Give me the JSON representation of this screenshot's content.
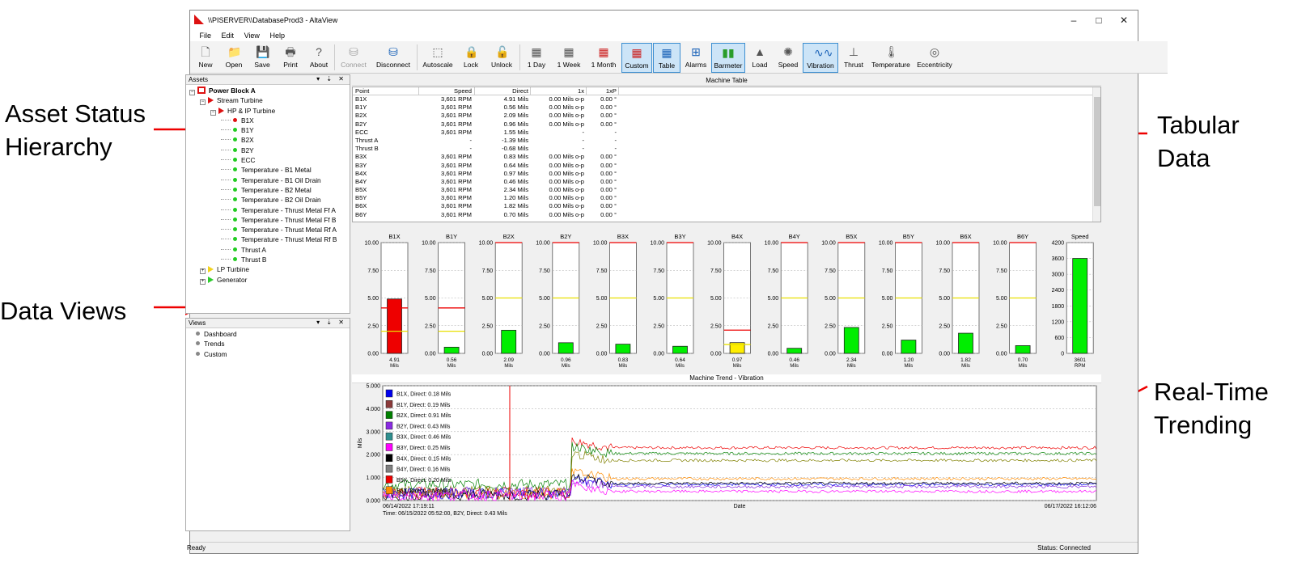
{
  "callouts": {
    "asset_status": "Asset Status\nHierarchy",
    "tabular": "Tabular\nData",
    "data_views": "Data Views",
    "trending": "Real-Time\nTrending"
  },
  "window": {
    "title": "\\\\PISERVER\\\\DatabaseProd3 - AltaView",
    "controls": [
      "–",
      "□",
      "✕"
    ]
  },
  "menu": [
    "File",
    "Edit",
    "View",
    "Help"
  ],
  "toolbar": [
    {
      "label": "New",
      "icon": "new-file-icon",
      "glyph": "🗋"
    },
    {
      "label": "Open",
      "icon": "folder-icon",
      "glyph": "📁"
    },
    {
      "label": "Save",
      "icon": "save-icon",
      "glyph": "💾"
    },
    {
      "label": "Print",
      "icon": "print-icon",
      "glyph": "🖶"
    },
    {
      "label": "About",
      "icon": "help-icon",
      "glyph": "?"
    },
    {
      "label": "Connect",
      "icon": "database-icon",
      "glyph": "⛁",
      "disabled": true
    },
    {
      "label": "Disconnect",
      "icon": "database-icon",
      "glyph": "⛁"
    },
    {
      "label": "Autoscale",
      "icon": "autoscale-icon",
      "glyph": "⬚"
    },
    {
      "label": "Lock",
      "icon": "lock-icon",
      "glyph": "🔒"
    },
    {
      "label": "Unlock",
      "icon": "unlock-icon",
      "glyph": "🔓"
    },
    {
      "label": "1 Day",
      "icon": "calendar-icon",
      "glyph": "▦"
    },
    {
      "label": "1 Week",
      "icon": "calendar-icon",
      "glyph": "▦"
    },
    {
      "label": "1 Month",
      "icon": "calendar-icon",
      "glyph": "▦"
    },
    {
      "label": "Custom",
      "icon": "calendar-custom-icon",
      "glyph": "▦",
      "selected": true
    },
    {
      "label": "Table",
      "icon": "table-icon",
      "glyph": "▦",
      "selected": true
    },
    {
      "label": "Alarms",
      "icon": "alarms-icon",
      "glyph": "⊞"
    },
    {
      "label": "Barmeter",
      "icon": "barmeter-icon",
      "glyph": "▮▮",
      "selected": true
    },
    {
      "label": "Load",
      "icon": "load-icon",
      "glyph": "▲"
    },
    {
      "label": "Speed",
      "icon": "speed-icon",
      "glyph": "✺"
    },
    {
      "label": "Vibration",
      "icon": "vibration-icon",
      "glyph": "∿∿",
      "selected": true
    },
    {
      "label": "Thrust",
      "icon": "thrust-icon",
      "glyph": "⊥"
    },
    {
      "label": "Temperature",
      "icon": "thermometer-icon",
      "glyph": "🌡"
    },
    {
      "label": "Eccentricity",
      "icon": "eccentricity-icon",
      "glyph": "◎"
    }
  ],
  "assets": {
    "title": "Assets",
    "panel_buttons": "▾ ⇣ ✕",
    "items": [
      {
        "label": "Power Block A",
        "level": 0,
        "kind": "root",
        "expand": "−"
      },
      {
        "label": "Stream Turbine",
        "level": 1,
        "kind": "flag",
        "expand": "−"
      },
      {
        "label": "HP & IP Turbine",
        "level": 2,
        "kind": "flag",
        "expand": "−"
      },
      {
        "label": "B1X",
        "level": 3,
        "status": "#e01010"
      },
      {
        "label": "B1Y",
        "level": 3,
        "status": "#22cc22"
      },
      {
        "label": "B2X",
        "level": 3,
        "status": "#22cc22"
      },
      {
        "label": "B2Y",
        "level": 3,
        "status": "#22cc22"
      },
      {
        "label": "ECC",
        "level": 3,
        "status": "#22cc22"
      },
      {
        "label": "Temperature - B1 Metal",
        "level": 3,
        "status": "#22cc22"
      },
      {
        "label": "Temperature - B1 Oil Drain",
        "level": 3,
        "status": "#22cc22"
      },
      {
        "label": "Temperature - B2 Metal",
        "level": 3,
        "status": "#22cc22"
      },
      {
        "label": "Temperature - B2 Oil Drain",
        "level": 3,
        "status": "#22cc22"
      },
      {
        "label": "Temperature - Thrust Metal Ff A",
        "level": 3,
        "status": "#22cc22"
      },
      {
        "label": "Temperature - Thrust Metal Ff B",
        "level": 3,
        "status": "#22cc22"
      },
      {
        "label": "Temperature - Thrust Metal Rf A",
        "level": 3,
        "status": "#22cc22"
      },
      {
        "label": "Temperature - Thrust Metal Rf B",
        "level": 3,
        "status": "#22cc22"
      },
      {
        "label": "Thrust A",
        "level": 3,
        "status": "#22cc22"
      },
      {
        "label": "Thrust B",
        "level": 3,
        "status": "#22cc22"
      },
      {
        "label": "LP Turbine",
        "level": 1,
        "kind": "yflag",
        "expand": "+"
      },
      {
        "label": "Generator",
        "level": 1,
        "kind": "gflag",
        "expand": "+"
      }
    ]
  },
  "views": {
    "title": "Views",
    "panel_buttons": "▾ ⇣ ✕",
    "items": [
      "Dashboard",
      "Trends",
      "Custom"
    ]
  },
  "machine_table": {
    "title": "Machine Table",
    "columns": [
      "Point",
      "Speed",
      "Direct",
      "1x",
      "1xP"
    ],
    "rows": [
      [
        "B1X",
        "3,601 RPM",
        "4.91 Mils",
        "0.00 Mils o-p",
        "0.00 °"
      ],
      [
        "B1Y",
        "3,601 RPM",
        "0.56 Mils",
        "0.00 Mils o-p",
        "0.00 °"
      ],
      [
        "B2X",
        "3,601 RPM",
        "2.09 Mils",
        "0.00 Mils o-p",
        "0.00 °"
      ],
      [
        "B2Y",
        "3,601 RPM",
        "0.96 Mils",
        "0.00 Mils o-p",
        "0.00 °"
      ],
      [
        "ECC",
        "3,601 RPM",
        "1.55 Mils",
        "-",
        "-"
      ],
      [
        "Thrust A",
        "-",
        "-1.39 Mils",
        "-",
        "-"
      ],
      [
        "Thrust B",
        "-",
        "-0.68 Mils",
        "-",
        "-"
      ],
      [
        "B3X",
        "3,601 RPM",
        "0.83 Mils",
        "0.00 Mils o-p",
        "0.00 °"
      ],
      [
        "B3Y",
        "3,601 RPM",
        "0.64 Mils",
        "0.00 Mils o-p",
        "0.00 °"
      ],
      [
        "B4X",
        "3,601 RPM",
        "0.97 Mils",
        "0.00 Mils o-p",
        "0.00 °"
      ],
      [
        "B4Y",
        "3,601 RPM",
        "0.46 Mils",
        "0.00 Mils o-p",
        "0.00 °"
      ],
      [
        "B5X",
        "3,601 RPM",
        "2.34 Mils",
        "0.00 Mils o-p",
        "0.00 °"
      ],
      [
        "B5Y",
        "3,601 RPM",
        "1.20 Mils",
        "0.00 Mils o-p",
        "0.00 °"
      ],
      [
        "B6X",
        "3,601 RPM",
        "1.82 Mils",
        "0.00 Mils o-p",
        "0.00 °"
      ],
      [
        "B6Y",
        "3,601 RPM",
        "0.70 Mils",
        "0.00 Mils o-p",
        "0.00 °"
      ]
    ]
  },
  "chart_data": [
    {
      "type": "bar",
      "title": "",
      "ticks": [
        "10.00",
        "7.50",
        "5.00",
        "2.50",
        "0.00"
      ],
      "ylim": [
        0,
        10
      ],
      "unit": "Mils",
      "gauges": [
        {
          "name": "B1X",
          "value": 4.91,
          "label": "4.91",
          "color": "#ee0000",
          "alarm": 4.1,
          "alert": 2.0
        },
        {
          "name": "B1Y",
          "value": 0.56,
          "label": "0.56",
          "color": "#00ee00",
          "alarm": 4.1,
          "alert": 2.0
        },
        {
          "name": "B2X",
          "value": 2.09,
          "label": "2.09",
          "color": "#00ee00",
          "alarm": 10,
          "alert": 5.0
        },
        {
          "name": "B2Y",
          "value": 0.96,
          "label": "0.96",
          "color": "#00ee00",
          "alarm": 10,
          "alert": 5.0
        },
        {
          "name": "B3X",
          "value": 0.83,
          "label": "0.83",
          "color": "#00ee00",
          "alarm": 10,
          "alert": 5.0
        },
        {
          "name": "B3Y",
          "value": 0.64,
          "label": "0.64",
          "color": "#00ee00",
          "alarm": 10,
          "alert": 5.0
        },
        {
          "name": "B4X",
          "value": 0.97,
          "label": "0.97",
          "color": "#ffee00",
          "alarm": 2.1,
          "alert": 0.8
        },
        {
          "name": "B4Y",
          "value": 0.46,
          "label": "0.46",
          "color": "#00ee00",
          "alarm": 10,
          "alert": 5.0
        },
        {
          "name": "B5X",
          "value": 2.34,
          "label": "2.34",
          "color": "#00ee00",
          "alarm": 10,
          "alert": 5.0
        },
        {
          "name": "B5Y",
          "value": 1.2,
          "label": "1.20",
          "color": "#00ee00",
          "alarm": 10,
          "alert": 5.0
        },
        {
          "name": "B6X",
          "value": 1.82,
          "label": "1.82",
          "color": "#00ee00",
          "alarm": 10,
          "alert": 5.0
        },
        {
          "name": "B6Y",
          "value": 0.7,
          "label": "0.70",
          "color": "#00ee00",
          "alarm": 10,
          "alert": 5.0
        }
      ]
    },
    {
      "type": "bar",
      "name": "Speed",
      "ticks": [
        "4200",
        "3600",
        "3000",
        "2400",
        "1800",
        "1200",
        "600",
        "0"
      ],
      "ylim": [
        0,
        4200
      ],
      "value": 3601,
      "label": "3601",
      "unit": "RPM",
      "color": "#00ee00"
    },
    {
      "type": "line",
      "title": "Machine Trend - Vibration",
      "xlabel": "Date",
      "ylabel": "Mils",
      "ylim": [
        0,
        5
      ],
      "yticks": [
        "5.000",
        "4.000",
        "3.000",
        "2.000",
        "1.000",
        "0.000"
      ],
      "x_start": "06/14/2022 17:19:11",
      "x_end": "06/17/2022 16:12:06",
      "cursor_readout": "Time: 06/15/2022 05:52:00, B2Y, Direct: 0.43 Mils",
      "legend": [
        {
          "label": "B1X, Direct: 0.18 Mils",
          "color": "#0000ee"
        },
        {
          "label": "B1Y, Direct: 0.19 Mils",
          "color": "#8b3a3a"
        },
        {
          "label": "B2X, Direct: 0.91 Mils",
          "color": "#008000"
        },
        {
          "label": "B2Y, Direct: 0.43 Mils",
          "color": "#8a2be2"
        },
        {
          "label": "B3X, Direct: 0.46 Mils",
          "color": "#2f8f8f"
        },
        {
          "label": "B3Y, Direct: 0.25 Mils",
          "color": "#ff00ff"
        },
        {
          "label": "B4X, Direct: 0.15 Mils",
          "color": "#000000"
        },
        {
          "label": "B4Y, Direct: 0.16 Mils",
          "color": "#808080"
        },
        {
          "label": "B5X, Direct: 0.20 Mils",
          "color": "#ee0000"
        },
        {
          "label": "B5Y, Direct: 0.18 Mils",
          "color": "#ff8c00"
        }
      ],
      "series_levels": [
        {
          "color": "#ee0000",
          "before": 0.35,
          "after": 2.3
        },
        {
          "color": "#008000",
          "before": 0.7,
          "after": 2.05
        },
        {
          "color": "#808000",
          "before": 0.4,
          "after": 1.75
        },
        {
          "color": "#ff8c00",
          "before": 0.3,
          "after": 0.95
        },
        {
          "color": "#0000ee",
          "before": 0.3,
          "after": 0.7
        },
        {
          "color": "#000000",
          "before": 0.25,
          "after": 0.75
        },
        {
          "color": "#8a2be2",
          "before": 0.35,
          "after": 0.6
        },
        {
          "color": "#ff00ff",
          "before": 0.2,
          "after": 0.4
        }
      ]
    }
  ],
  "status": {
    "left": "Ready",
    "right": "Status: Connected"
  }
}
